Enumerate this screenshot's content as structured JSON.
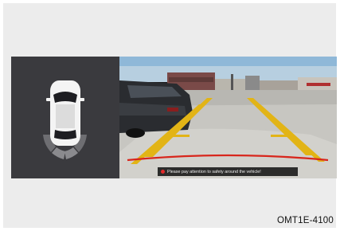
{
  "screen": {
    "warning_text": "Please pay attention to safety around the vehicle!",
    "warning_icon": "alert-dot-icon"
  },
  "caption": {
    "code": "OMT1E-4100"
  },
  "colors": {
    "panel_bg": "#3a3a3e",
    "guide_yellow": "#e2b416",
    "guide_red": "#d8261c",
    "sensor_gray": "#777777"
  }
}
